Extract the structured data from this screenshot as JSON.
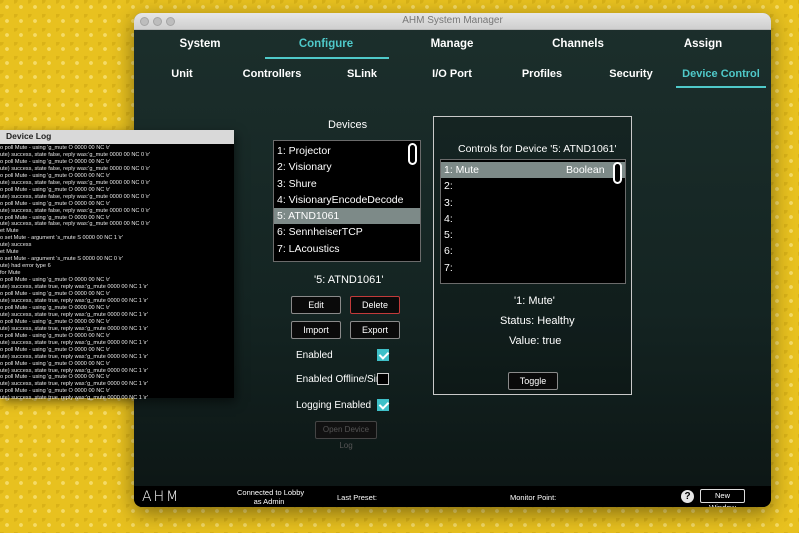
{
  "window": {
    "title": "AHM System Manager"
  },
  "nav_main": [
    {
      "label": "System"
    },
    {
      "label": "Configure"
    },
    {
      "label": "Manage"
    },
    {
      "label": "Channels"
    },
    {
      "label": "Assign"
    }
  ],
  "nav_sub": [
    {
      "label": "Unit"
    },
    {
      "label": "Controllers"
    },
    {
      "label": "SLink"
    },
    {
      "label": "I/O Port"
    },
    {
      "label": "Profiles"
    },
    {
      "label": "Security"
    },
    {
      "label": "Device Control"
    }
  ],
  "devices": {
    "heading": "Devices",
    "items": [
      "1: Projector",
      "2: Visionary",
      "3: Shure",
      "4: VisionaryEncodeDecode",
      "5: ATND1061",
      "6: SennheiserTCP",
      "7: LAcoustics"
    ],
    "selected_label": "'5: ATND1061'",
    "edit": "Edit",
    "delete": "Delete",
    "import": "Import",
    "export": "Export",
    "enabled": "Enabled",
    "enabled_offline": "Enabled Offline/Sim",
    "logging_enabled": "Logging Enabled",
    "open_log": "Open Device Log"
  },
  "controls": {
    "heading": "Controls for Device '5: ATND1061'",
    "rows": [
      {
        "label": "1: Mute",
        "type": "Boolean"
      },
      {
        "label": "2:",
        "type": ""
      },
      {
        "label": "3:",
        "type": ""
      },
      {
        "label": "4:",
        "type": ""
      },
      {
        "label": "5:",
        "type": ""
      },
      {
        "label": "6:",
        "type": ""
      },
      {
        "label": "7:",
        "type": ""
      }
    ],
    "selected_label": "'1: Mute'",
    "status": "Status: Healthy",
    "value": "Value: true",
    "toggle": "Toggle"
  },
  "statusbar": {
    "logo": "AHM",
    "connected_line1": "Connected to Lobby",
    "connected_line2": "as Admin",
    "last_preset": "Last Preset:",
    "monitor_point": "Monitor Point:",
    "help": "?",
    "new_window": "New Window"
  },
  "device_log": {
    "title": "Device Log",
    "lines": [
      "o poll Mute - using 'g_mute O 0000 00 NC \\r'",
      "ute) success, state false, reply was:'g_mute 0000 00 NC 0 \\r'",
      "o poll Mute - using 'g_mute O 0000 00 NC \\r'",
      "ute) success, state false, reply was:'g_mute 0000 00 NC 0 \\r'",
      "o poll Mute - using 'g_mute O 0000 00 NC \\r'",
      "ute) success, state false, reply was:'g_mute 0000 00 NC 0 \\r'",
      "o poll Mute - using 'g_mute O 0000 00 NC \\r'",
      "ute) success, state false, reply was:'g_mute 0000 00 NC 0 \\r'",
      "o poll Mute - using 'g_mute O 0000 00 NC \\r'",
      "ute) success, state false, reply was:'g_mute 0000 00 NC 0 \\r'",
      "o poll Mute - using 'g_mute O 0000 00 NC \\r'",
      "ute) success, state false, reply was:'g_mute 0000 00 NC 0 \\r'",
      "et Mute",
      "o set Mute - argument 's_mute S 0000 00 NC 1 \\r'",
      "ute) success",
      "et Mute",
      "o set Mute - argument 's_mute S 0000 00 NC 0 \\r'",
      "ute) had error type 6",
      "for Mute",
      "o poll Mute - using 'g_mute O 0000 00 NC \\r'",
      "ute) success, state true, reply was:'g_mute 0000 00 NC 1 \\r'",
      "o poll Mute - using 'g_mute O 0000 00 NC \\r'",
      "ute) success, state true, reply was:'g_mute 0000 00 NC 1 \\r'",
      "o poll Mute - using 'g_mute O 0000 00 NC \\r'",
      "ute) success, state true, reply was:'g_mute 0000 00 NC 1 \\r'",
      "o poll Mute - using 'g_mute O 0000 00 NC \\r'",
      "ute) success, state true, reply was:'g_mute 0000 00 NC 1 \\r'",
      "o poll Mute - using 'g_mute O 0000 00 NC \\r'",
      "ute) success, state true, reply was:'g_mute 0000 00 NC 1 \\r'",
      "o poll Mute - using 'g_mute O 0000 00 NC \\r'",
      "ute) success, state true, reply was:'g_mute 0000 00 NC 1 \\r'",
      "o poll Mute - using 'g_mute O 0000 00 NC \\r'",
      "ute) success, state true, reply was:'g_mute 0000 00 NC 1 \\r'",
      "o poll Mute - using 'g_mute O 0000 00 NC \\r'",
      "ute) success, state true, reply was:'g_mute 0000 00 NC 1 \\r'",
      "o poll Mute - using 'g_mute O 0000 00 NC \\r'",
      "ute) success, state true, reply was:'g_mute 0000 00 NC 1 \\r'"
    ]
  },
  "colors": {
    "accent": "#4fc9c9",
    "checkbox_on": "#3fc0c8",
    "selection": "#7d8a88",
    "delete_border": "#c23a3a"
  }
}
